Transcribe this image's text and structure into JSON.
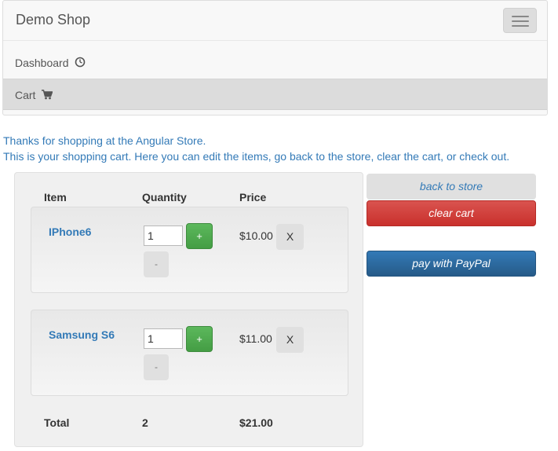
{
  "navbar": {
    "brand": "Demo Shop",
    "toggle_icon": "hamburger-menu-icon",
    "items": [
      {
        "label": "Dashboard",
        "icon": "dashboard-icon"
      },
      {
        "label": "Cart",
        "icon": "shopping-cart-icon",
        "active": true
      }
    ]
  },
  "intro": {
    "line1": "Thanks for shopping at the Angular Store.",
    "line2": "This is your shopping cart. Here you can edit the items, go back to the store, clear the cart, or check out."
  },
  "cart": {
    "columns": {
      "item": "Item",
      "quantity": "Quantity",
      "price": "Price"
    },
    "items": [
      {
        "name": "IPhone6",
        "quantity": "1",
        "plus": "+",
        "minus": "-",
        "price": "$10.00",
        "remove": "X"
      },
      {
        "name": "Samsung S6",
        "quantity": "1",
        "plus": "+",
        "minus": "-",
        "price": "$11.00",
        "remove": "X"
      }
    ],
    "total": {
      "label": "Total",
      "quantity": "2",
      "price": "$21.00"
    }
  },
  "actions": {
    "back_to_store": "back to store",
    "clear_cart": "clear cart",
    "pay_with_paypal": "pay with PayPal"
  },
  "colors": {
    "link": "#337ab7",
    "success": "#5cb85c",
    "danger": "#d9534f",
    "primary": "#337ab7"
  }
}
